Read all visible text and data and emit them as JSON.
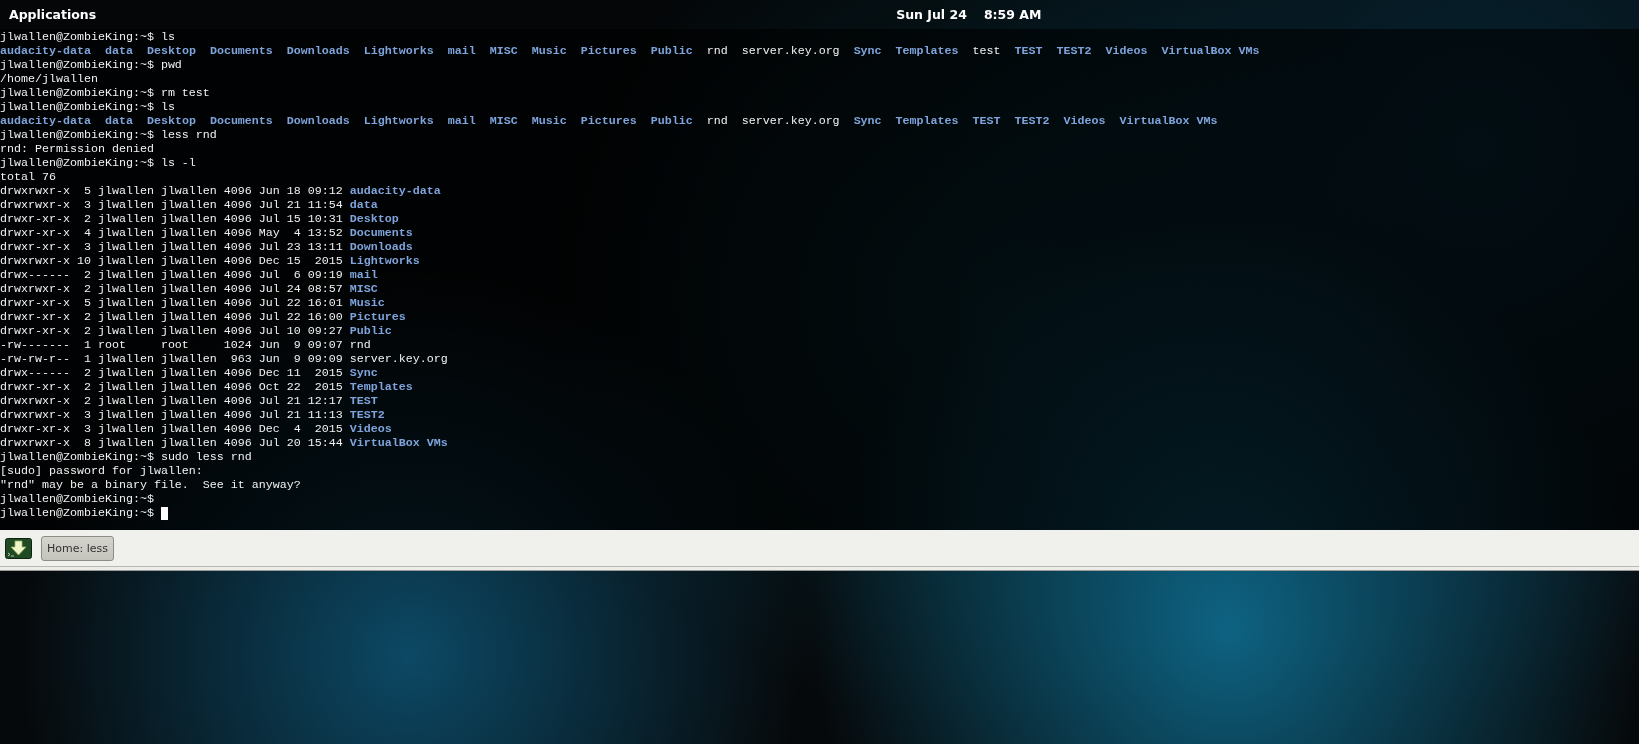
{
  "top_panel": {
    "menu": "Applications",
    "date": "Sun Jul 24",
    "time": "8:59 AM"
  },
  "terminal": {
    "cursor_visible": true,
    "lines": [
      {
        "kind": "plain",
        "text": "jlwallen@ZombieKing:~$ ls"
      },
      {
        "kind": "listing",
        "items": [
          {
            "name": "audacity-data",
            "directory": true
          },
          {
            "name": "data",
            "directory": true
          },
          {
            "name": "Desktop",
            "directory": true
          },
          {
            "name": "Documents",
            "directory": true
          },
          {
            "name": "Downloads",
            "directory": true
          },
          {
            "name": "Lightworks",
            "directory": true
          },
          {
            "name": "mail",
            "directory": true
          },
          {
            "name": "MISC",
            "directory": true
          },
          {
            "name": "Music",
            "directory": true
          },
          {
            "name": "Pictures",
            "directory": true
          },
          {
            "name": "Public",
            "directory": true
          },
          {
            "name": "rnd",
            "directory": false
          },
          {
            "name": "server.key.org",
            "directory": false
          },
          {
            "name": "Sync",
            "directory": true
          },
          {
            "name": "Templates",
            "directory": true
          },
          {
            "name": "test",
            "directory": false
          },
          {
            "name": "TEST",
            "directory": true
          },
          {
            "name": "TEST2",
            "directory": true
          },
          {
            "name": "Videos",
            "directory": true
          },
          {
            "name": "VirtualBox VMs",
            "directory": true
          }
        ]
      },
      {
        "kind": "plain",
        "text": "jlwallen@ZombieKing:~$ pwd"
      },
      {
        "kind": "plain",
        "text": "/home/jlwallen"
      },
      {
        "kind": "plain",
        "text": "jlwallen@ZombieKing:~$ rm test"
      },
      {
        "kind": "plain",
        "text": "jlwallen@ZombieKing:~$ ls"
      },
      {
        "kind": "listing",
        "items": [
          {
            "name": "audacity-data",
            "directory": true
          },
          {
            "name": "data",
            "directory": true
          },
          {
            "name": "Desktop",
            "directory": true
          },
          {
            "name": "Documents",
            "directory": true
          },
          {
            "name": "Downloads",
            "directory": true
          },
          {
            "name": "Lightworks",
            "directory": true
          },
          {
            "name": "mail",
            "directory": true
          },
          {
            "name": "MISC",
            "directory": true
          },
          {
            "name": "Music",
            "directory": true
          },
          {
            "name": "Pictures",
            "directory": true
          },
          {
            "name": "Public",
            "directory": true
          },
          {
            "name": "rnd",
            "directory": false
          },
          {
            "name": "server.key.org",
            "directory": false
          },
          {
            "name": "Sync",
            "directory": true
          },
          {
            "name": "Templates",
            "directory": true
          },
          {
            "name": "TEST",
            "directory": true
          },
          {
            "name": "TEST2",
            "directory": true
          },
          {
            "name": "Videos",
            "directory": true
          },
          {
            "name": "VirtualBox VMs",
            "directory": true
          }
        ]
      },
      {
        "kind": "plain",
        "text": "jlwallen@ZombieKing:~$ less rnd"
      },
      {
        "kind": "plain",
        "text": "rnd: Permission denied"
      },
      {
        "kind": "plain",
        "text": "jlwallen@ZombieKing:~$ ls -l"
      },
      {
        "kind": "plain",
        "text": "total 76"
      },
      {
        "kind": "long",
        "info": "drwxrwxr-x  5 jlwallen jlwallen 4096 Jun 18 09:12",
        "name": "audacity-data",
        "directory": true
      },
      {
        "kind": "long",
        "info": "drwxrwxr-x  3 jlwallen jlwallen 4096 Jul 21 11:54",
        "name": "data",
        "directory": true
      },
      {
        "kind": "long",
        "info": "drwxr-xr-x  2 jlwallen jlwallen 4096 Jul 15 10:31",
        "name": "Desktop",
        "directory": true
      },
      {
        "kind": "long",
        "info": "drwxr-xr-x  4 jlwallen jlwallen 4096 May  4 13:52",
        "name": "Documents",
        "directory": true
      },
      {
        "kind": "long",
        "info": "drwxr-xr-x  3 jlwallen jlwallen 4096 Jul 23 13:11",
        "name": "Downloads",
        "directory": true
      },
      {
        "kind": "long",
        "info": "drwxrwxr-x 10 jlwallen jlwallen 4096 Dec 15  2015",
        "name": "Lightworks",
        "directory": true
      },
      {
        "kind": "long",
        "info": "drwx------  2 jlwallen jlwallen 4096 Jul  6 09:19",
        "name": "mail",
        "directory": true
      },
      {
        "kind": "long",
        "info": "drwxrwxr-x  2 jlwallen jlwallen 4096 Jul 24 08:57",
        "name": "MISC",
        "directory": true
      },
      {
        "kind": "long",
        "info": "drwxr-xr-x  5 jlwallen jlwallen 4096 Jul 22 16:01",
        "name": "Music",
        "directory": true
      },
      {
        "kind": "long",
        "info": "drwxr-xr-x  2 jlwallen jlwallen 4096 Jul 22 16:00",
        "name": "Pictures",
        "directory": true
      },
      {
        "kind": "long",
        "info": "drwxr-xr-x  2 jlwallen jlwallen 4096 Jul 10 09:27",
        "name": "Public",
        "directory": true
      },
      {
        "kind": "long",
        "info": "-rw-------  1 root     root     1024 Jun  9 09:07",
        "name": "rnd",
        "directory": false
      },
      {
        "kind": "long",
        "info": "-rw-rw-r--  1 jlwallen jlwallen  963 Jun  9 09:09",
        "name": "server.key.org",
        "directory": false
      },
      {
        "kind": "long",
        "info": "drwx------  2 jlwallen jlwallen 4096 Dec 11  2015",
        "name": "Sync",
        "directory": true
      },
      {
        "kind": "long",
        "info": "drwxr-xr-x  2 jlwallen jlwallen 4096 Oct 22  2015",
        "name": "Templates",
        "directory": true
      },
      {
        "kind": "long",
        "info": "drwxrwxr-x  2 jlwallen jlwallen 4096 Jul 21 12:17",
        "name": "TEST",
        "directory": true
      },
      {
        "kind": "long",
        "info": "drwxrwxr-x  3 jlwallen jlwallen 4096 Jul 21 11:13",
        "name": "TEST2",
        "directory": true
      },
      {
        "kind": "long",
        "info": "drwxr-xr-x  3 jlwallen jlwallen 4096 Dec  4  2015",
        "name": "Videos",
        "directory": true
      },
      {
        "kind": "long",
        "info": "drwxrwxr-x  8 jlwallen jlwallen 4096 Jul 20 15:44",
        "name": "VirtualBox VMs",
        "directory": true
      },
      {
        "kind": "plain",
        "text": "jlwallen@ZombieKing:~$ sudo less rnd"
      },
      {
        "kind": "plain",
        "text": "[sudo] password for jlwallen:"
      },
      {
        "kind": "plain",
        "text": "\"rnd\" may be a binary file.  See it anyway?"
      },
      {
        "kind": "plain",
        "text": "jlwallen@ZombieKing:~$"
      },
      {
        "kind": "plain",
        "text": "jlwallen@ZombieKing:~$"
      }
    ]
  },
  "taskbar": {
    "tasks": [
      {
        "label": "Home: less",
        "selected": true
      }
    ]
  }
}
